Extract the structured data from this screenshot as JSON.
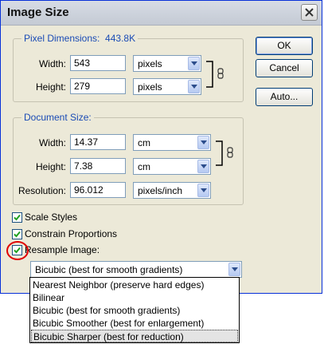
{
  "dialog": {
    "title": "Image Size"
  },
  "pixel_dimensions": {
    "legend": "Pixel Dimensions:",
    "size": "443.8K",
    "width_label": "Width:",
    "width_value": "543",
    "width_unit": "pixels",
    "height_label": "Height:",
    "height_value": "279",
    "height_unit": "pixels"
  },
  "document_size": {
    "legend": "Document Size:",
    "width_label": "Width:",
    "width_value": "14.37",
    "width_unit": "cm",
    "height_label": "Height:",
    "height_value": "7.38",
    "height_unit": "cm",
    "resolution_label": "Resolution:",
    "resolution_value": "96.012",
    "resolution_unit": "pixels/inch"
  },
  "buttons": {
    "ok": "OK",
    "cancel": "Cancel",
    "auto": "Auto..."
  },
  "options": {
    "scale_styles": "Scale Styles",
    "constrain": "Constrain Proportions",
    "resample": "Resample Image:",
    "scale_styles_checked": true,
    "constrain_checked": true,
    "resample_checked": true
  },
  "resample_method": {
    "selected": "Bicubic (best for smooth gradients)",
    "list": [
      "Nearest Neighbor (preserve hard edges)",
      "Bilinear",
      "Bicubic (best for smooth gradients)",
      "Bicubic Smoother (best for enlargement)",
      "Bicubic Sharper (best for reduction)"
    ],
    "highlighted_index": 4
  },
  "colors": {
    "legend_blue": "#1a4bb5",
    "annotation_circle": "#e00000"
  }
}
